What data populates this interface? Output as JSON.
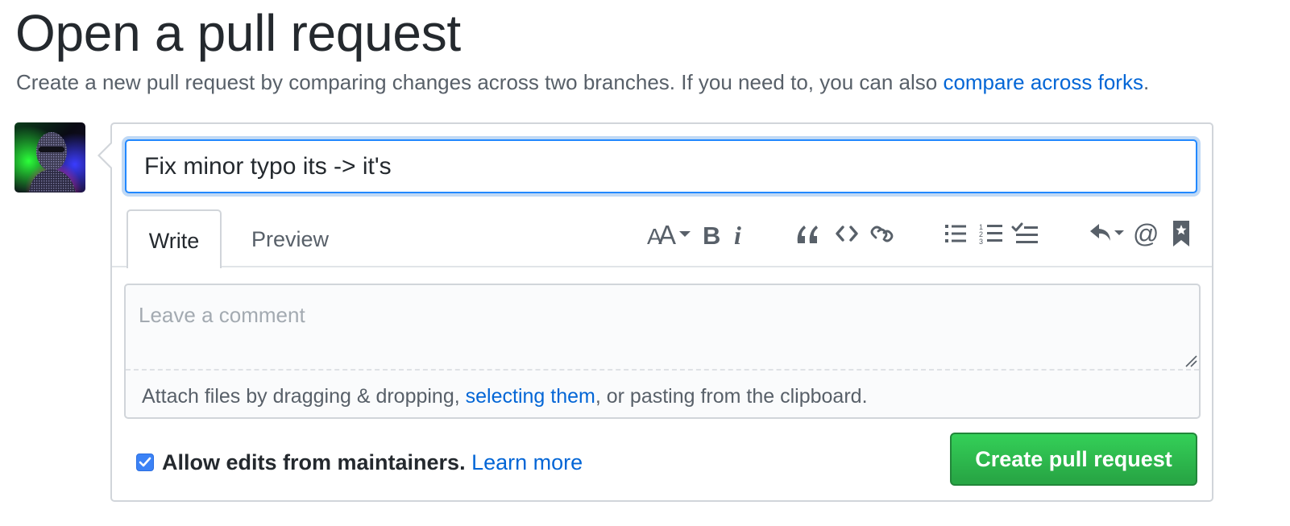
{
  "header": {
    "title": "Open a pull request",
    "description": "Create a new pull request by comparing changes across two branches. If you need to, you can also ",
    "compare_link": "compare across forks",
    "description_end": "."
  },
  "form": {
    "title_value": "Fix minor typo its -> it's",
    "tabs": {
      "write": "Write",
      "preview": "Preview"
    },
    "toolbar": [
      "text-size-icon",
      "bold-icon",
      "italic-icon",
      "quote-icon",
      "code-icon",
      "link-icon",
      "bulleted-list-icon",
      "numbered-list-icon",
      "task-list-icon",
      "reply-icon",
      "mention-icon",
      "bookmark-icon"
    ],
    "comment_placeholder": "Leave a comment",
    "attach": {
      "prefix": "Attach files by dragging & dropping, ",
      "link": "selecting them",
      "suffix": ", or pasting from the clipboard."
    },
    "allow_edits": {
      "label": "Allow edits from maintainers.",
      "learn_more": "Learn more",
      "checked": true
    },
    "submit_label": "Create pull request"
  },
  "colors": {
    "link": "#0366d6",
    "focus_border": "#2188ff",
    "button_green": "#28a745",
    "checkbox_blue": "#3b82f6"
  }
}
